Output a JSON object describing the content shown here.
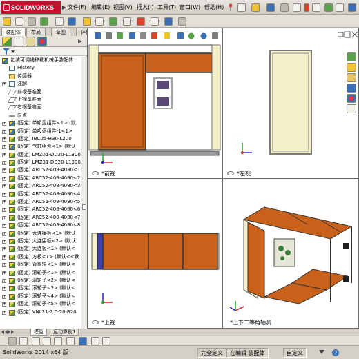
{
  "app": {
    "logo_text": "SOLIDWORKS",
    "menu": [
      "文件(F)",
      "编辑(E)",
      "视图(V)",
      "插入(I)",
      "工具(T)",
      "窗口(W)",
      "帮助(H)"
    ]
  },
  "command_manager": {
    "tabs": [
      "装配体",
      "布局",
      "草图",
      "评估"
    ],
    "active_tab": "装配体"
  },
  "feature_manager": {
    "tabs": [
      "feature-tree",
      "property",
      "config",
      "display"
    ],
    "items": [
      {
        "label": "包装可调线移载机械手装配体",
        "icon": "assembly",
        "expander": ""
      },
      {
        "label": "History",
        "icon": "history",
        "expander": ""
      },
      {
        "label": "传感器",
        "icon": "sensor",
        "expander": ""
      },
      {
        "label": "注解",
        "icon": "note",
        "expander": "+"
      },
      {
        "label": "前视基准面",
        "icon": "plane",
        "expander": ""
      },
      {
        "label": "上视基准面",
        "icon": "plane",
        "expander": ""
      },
      {
        "label": "右视基准面",
        "icon": "plane",
        "expander": ""
      },
      {
        "label": "原点",
        "icon": "origin",
        "expander": ""
      },
      {
        "label": "(固定) 单吸盘组件<1> (默",
        "icon": "assembly",
        "expander": "+"
      },
      {
        "label": "(固定) 单吸盘组件-1<1>",
        "icon": "assembly",
        "expander": "+"
      },
      {
        "label": "(固定) IBC05-H30-L200",
        "icon": "part",
        "expander": "+"
      },
      {
        "label": "(固定) 气缸组合<1> (默认",
        "icon": "assembly",
        "expander": "+"
      },
      {
        "label": "(固定) LMZ01-DD20-L1300",
        "icon": "part",
        "expander": "+"
      },
      {
        "label": "(固定) LMZ01-DD20-L1300",
        "icon": "part",
        "expander": "+"
      },
      {
        "label": "(固定) ARC52-408-4080<1",
        "icon": "part",
        "expander": "+"
      },
      {
        "label": "(固定) ARC52-408-4080<2",
        "icon": "part",
        "expander": "+"
      },
      {
        "label": "(固定) ARC52-408-4080<3",
        "icon": "part",
        "expander": "+"
      },
      {
        "label": "(固定) ARC52-408-4080<4",
        "icon": "part",
        "expander": "+"
      },
      {
        "label": "(固定) ARC52-408-4080<5",
        "icon": "part",
        "expander": "+"
      },
      {
        "label": "(固定) ARC52-408-4080<6",
        "icon": "part",
        "expander": "+"
      },
      {
        "label": "(固定) ARC52-408-4080<7",
        "icon": "part",
        "expander": "+"
      },
      {
        "label": "(固定) ARC52-408-4080<8",
        "icon": "part",
        "expander": "+"
      },
      {
        "label": "(固定) 大连接板<1> (默认",
        "icon": "part",
        "expander": "+"
      },
      {
        "label": "(固定) 大连接板<2> (默认",
        "icon": "part",
        "expander": "+"
      },
      {
        "label": "(固定) 大连板<1> (默认<",
        "icon": "part",
        "expander": "+"
      },
      {
        "label": "(固定) 方板<1> (默认<<默",
        "icon": "part",
        "expander": "+"
      },
      {
        "label": "(固定) 背靠轮<1> (默认<",
        "icon": "part",
        "expander": "+"
      },
      {
        "label": "(固定) 滚轮子<1> (默认<",
        "icon": "part",
        "expander": "+"
      },
      {
        "label": "(固定) 滚轮子<2> (默认<",
        "icon": "part",
        "expander": "+"
      },
      {
        "label": "(固定) 滚轮子<3> (默认<",
        "icon": "part",
        "expander": "+"
      },
      {
        "label": "(固定) 滚轮子<4> (默认<",
        "icon": "part",
        "expander": "+"
      },
      {
        "label": "(固定) 滚轮子<5> (默认<",
        "icon": "part",
        "expander": "+"
      },
      {
        "label": "(固定) VNL21-2.0-20-B20",
        "icon": "part",
        "expander": "+"
      }
    ]
  },
  "bottom_tabs": [
    "模型",
    "运动算例1"
  ],
  "viewports": {
    "front": {
      "label": "*前视"
    },
    "left": {
      "label": "*左视"
    },
    "top": {
      "label": "*上视"
    },
    "iso": {
      "label": "*上下二等角轴测"
    }
  },
  "status": {
    "app_version": "SolidWorks 2014 x64 版",
    "fully_defined": "完全定义",
    "editing": "在编辑  装配体",
    "custom": "自定义"
  },
  "colors": {
    "orange": "#c8621a",
    "frame": "#3a3a3a",
    "cream": "#f3efc8",
    "brand": "#c8102e"
  }
}
